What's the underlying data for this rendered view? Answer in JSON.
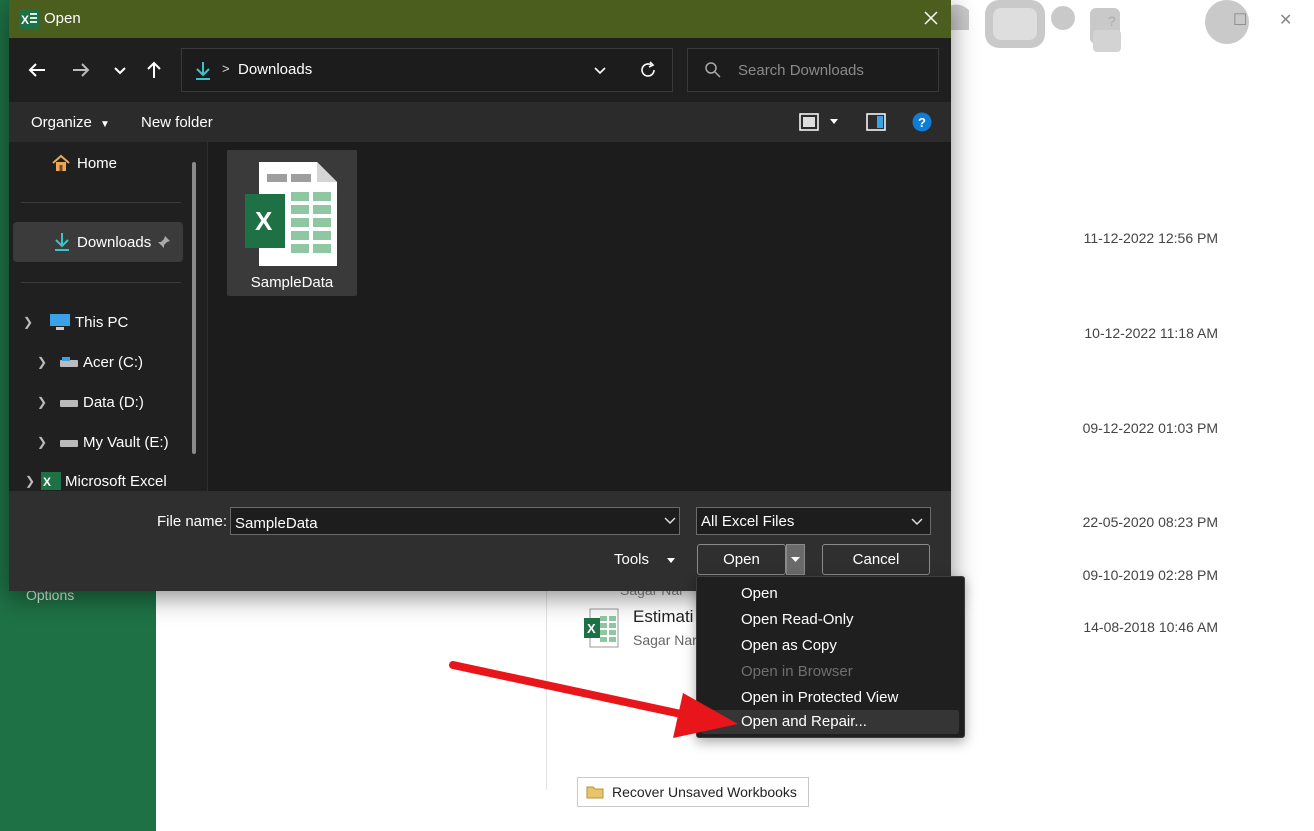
{
  "background": {
    "sidebar_options": "Options",
    "dates": [
      "11-12-2022 12:56 PM",
      "10-12-2022 11:18 AM",
      "09-12-2022 01:03 PM",
      "22-05-2020 08:23 PM",
      "09-10-2019 02:28 PM",
      "14-08-2018 10:46 AM"
    ],
    "file_name_partial": "Estimati",
    "file_author_partial": "Sagar Nar",
    "file_author_partial2": "Sagar Nar",
    "recover_button": "Recover Unsaved Workbooks",
    "window_help": "?",
    "colors": {
      "excel_green": "#1e7145"
    }
  },
  "dialog": {
    "title": "Open",
    "address": {
      "location": "Downloads",
      "separator": ">"
    },
    "search_placeholder": "Search Downloads",
    "toolbar": {
      "organize": "Organize",
      "new_folder": "New folder"
    },
    "nav": {
      "home": "Home",
      "downloads": "Downloads",
      "this_pc": "This PC",
      "drives": [
        "Acer (C:)",
        "Data (D:)",
        "My Vault (E:)"
      ],
      "microsoft_excel": "Microsoft Excel"
    },
    "files": [
      {
        "name": "SampleData",
        "icon": "excel-file-icon"
      }
    ],
    "file_name_label": "File name:",
    "file_name_value": "SampleData",
    "file_type": "All Excel Files",
    "tools": "Tools",
    "open_button": "Open",
    "cancel_button": "Cancel",
    "colors": {
      "titlebar": "#4b5e1e",
      "accent": "#0f7cd6"
    }
  },
  "open_menu": {
    "items": [
      {
        "label": "Open",
        "enabled": true
      },
      {
        "label": "Open Read-Only",
        "enabled": true
      },
      {
        "label": "Open as Copy",
        "enabled": true
      },
      {
        "label": "Open in Browser",
        "enabled": false
      },
      {
        "label": "Open in Protected View",
        "enabled": true
      },
      {
        "label": "Open and Repair...",
        "enabled": true,
        "highlighted": true
      }
    ]
  },
  "annotation": {
    "arrow_color": "#e8161b"
  }
}
